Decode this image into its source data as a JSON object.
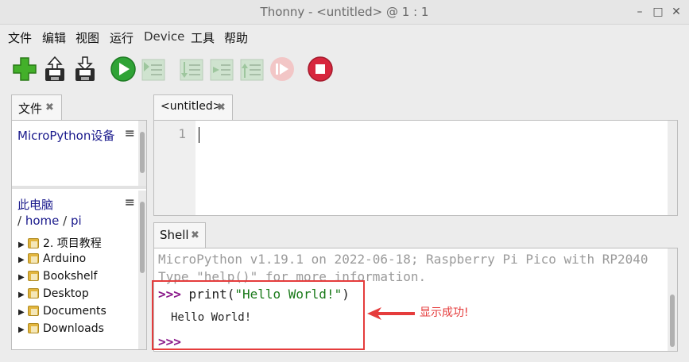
{
  "window": {
    "title": "Thonny  -  <untitled>  @  1 : 1",
    "controls": {
      "minimize": "–",
      "maximize": "□",
      "close": "✕"
    }
  },
  "menu": [
    "文件",
    "编辑",
    "视图",
    "运行",
    "Device",
    "工具",
    "帮助"
  ],
  "toolbar": {
    "buttons": [
      {
        "name": "new-icon",
        "enabled": true
      },
      {
        "name": "open-icon",
        "enabled": true
      },
      {
        "name": "save-icon",
        "enabled": true
      },
      {
        "name": "run-icon",
        "enabled": true
      },
      {
        "name": "debug-icon",
        "enabled": false
      },
      {
        "name": "step-over-icon",
        "enabled": false
      },
      {
        "name": "step-into-icon",
        "enabled": false
      },
      {
        "name": "step-out-icon",
        "enabled": false
      },
      {
        "name": "resume-icon",
        "enabled": false
      },
      {
        "name": "stop-icon",
        "enabled": true
      }
    ]
  },
  "files": {
    "tab_label": "文件",
    "tab_close": "✖",
    "device_section": {
      "title": "MicroPython设备",
      "menu": "≡"
    },
    "computer_section": {
      "title": "此电脑",
      "menu": "≡",
      "path_sep": "/",
      "path": [
        "home",
        "pi"
      ]
    },
    "items": [
      "2. 项目教程",
      "Arduino",
      "Bookshelf",
      "Desktop",
      "Documents",
      "Downloads"
    ],
    "expander": "▶"
  },
  "editor": {
    "tab_label": "<untitled>",
    "tab_close": "✖",
    "line_numbers": [
      "1"
    ]
  },
  "shell": {
    "tab_label": "Shell",
    "tab_close": "✖",
    "banner_line1": "MicroPython v1.19.1 on 2022-06-18; Raspberry Pi Pico with RP2040",
    "banner_line2": "Type \"help()\" for more information.",
    "prompt": ">>>",
    "command_func": "print(",
    "command_string": "\"Hello World!\"",
    "command_close": ")",
    "output": "Hello World!"
  },
  "annotation": {
    "text": "显示成功!",
    "color": "#e53c3c"
  },
  "colors": {
    "accent_link": "#1a1a8c",
    "prompt": "#8b1a8b",
    "string": "#1a7a1a",
    "banner": "#9a9a9a"
  }
}
